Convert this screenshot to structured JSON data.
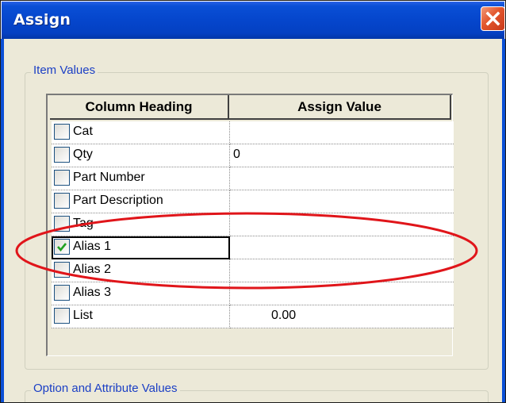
{
  "window": {
    "title": "Assign"
  },
  "groups": {
    "item_values": "Item Values",
    "option_attribute_values": "Option and Attribute Values"
  },
  "grid": {
    "headers": [
      "Column Heading",
      "Assign Value"
    ],
    "rows": [
      {
        "label": "Cat",
        "value": "",
        "checked": false
      },
      {
        "label": "Qty",
        "value": "0",
        "checked": false
      },
      {
        "label": "Part Number",
        "value": "",
        "checked": false
      },
      {
        "label": "Part Description",
        "value": "",
        "checked": false
      },
      {
        "label": "Tag",
        "value": "",
        "checked": false
      },
      {
        "label": "Alias 1",
        "value": "",
        "checked": true
      },
      {
        "label": "Alias 2",
        "value": "",
        "checked": false
      },
      {
        "label": "Alias 3",
        "value": "",
        "checked": false
      },
      {
        "label": "List",
        "value": "0.00",
        "checked": false
      }
    ]
  },
  "colors": {
    "titlebar": "#0546cc",
    "highlight_ellipse": "#e0151a",
    "checkmark": "#21a121",
    "group_label": "#1b3fc5"
  },
  "icons": {
    "close": "close-icon",
    "check": "checkmark-icon"
  }
}
